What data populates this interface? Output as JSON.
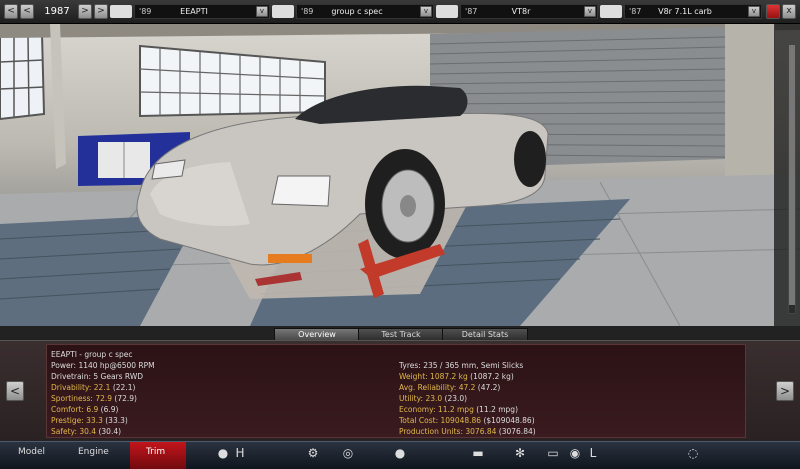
{
  "topbar": {
    "prev_label": "<",
    "prev2_label": "<",
    "year": "1987",
    "next_label": ">",
    "next2_label": ">",
    "dropdown_label": "v",
    "model": {
      "year": "'89",
      "name": "EEAPTI"
    },
    "trim": {
      "year": "'89",
      "name": "group c spec"
    },
    "engine": {
      "year": "'87",
      "name": "VT8r"
    },
    "variant": {
      "year": "'87",
      "name": "V8r 7.1L carb"
    },
    "save_icon": "floppy-icon",
    "close_label": "x"
  },
  "tabs": [
    {
      "label": "Overview"
    },
    {
      "label": "Test Track"
    },
    {
      "label": "Detail Stats"
    }
  ],
  "stats": {
    "title": "EEAPTI - group c spec",
    "left": [
      {
        "text": "Power: 1140 hp@6500 RPM"
      },
      {
        "text": "Drivetrain: 5 Gears RWD"
      },
      {
        "key": "Drivability:",
        "val": "22.1",
        "extra": "(22.1)"
      },
      {
        "key": "Sportiness:",
        "val": "72.9",
        "extra": "(72.9)"
      },
      {
        "key": "Comfort:",
        "val": "6.9",
        "extra": "(6.9)"
      },
      {
        "key": "Prestige:",
        "val": "33.3",
        "extra": "(33.3)"
      },
      {
        "key": "Safety:",
        "val": "30.4",
        "extra": "(30.4)"
      }
    ],
    "right": [
      {
        "text": "Tyres: 235 / 365 mm, Semi Slicks"
      },
      {
        "key": "Weight:",
        "val": "1087.2 kg",
        "extra": "(1087.2 kg)"
      },
      {
        "key": "Avg. Reliability:",
        "val": "47.2",
        "extra": "(47.2)"
      },
      {
        "key": "Utility:",
        "val": "23.0",
        "extra": "(23.0)"
      },
      {
        "key": "Economy:",
        "val": "11.2 mpg",
        "extra": "(11.2 mpg)"
      },
      {
        "key": "Total Cost:",
        "val": "109048.86",
        "extra": "($109048.86)"
      },
      {
        "key": "Production Units:",
        "val": "3076.84",
        "extra": "(3076.84)"
      }
    ],
    "prev_label": "<",
    "next_label": ">"
  },
  "bottomnav": {
    "model": "Model",
    "engine": "Engine",
    "trim": "Trim",
    "icons": [
      "chassis-icon",
      "gearbox-icon",
      "suspension-icon",
      "wheel-icon",
      "body-icon",
      "fan-icon",
      "interior-icon",
      "steering-icon",
      "seat-icon",
      "brake-icon",
      "settings-icon"
    ]
  },
  "colors": {
    "accent": "#c3141b",
    "highlight": "#e0b84a",
    "panel": "#2b1215"
  }
}
